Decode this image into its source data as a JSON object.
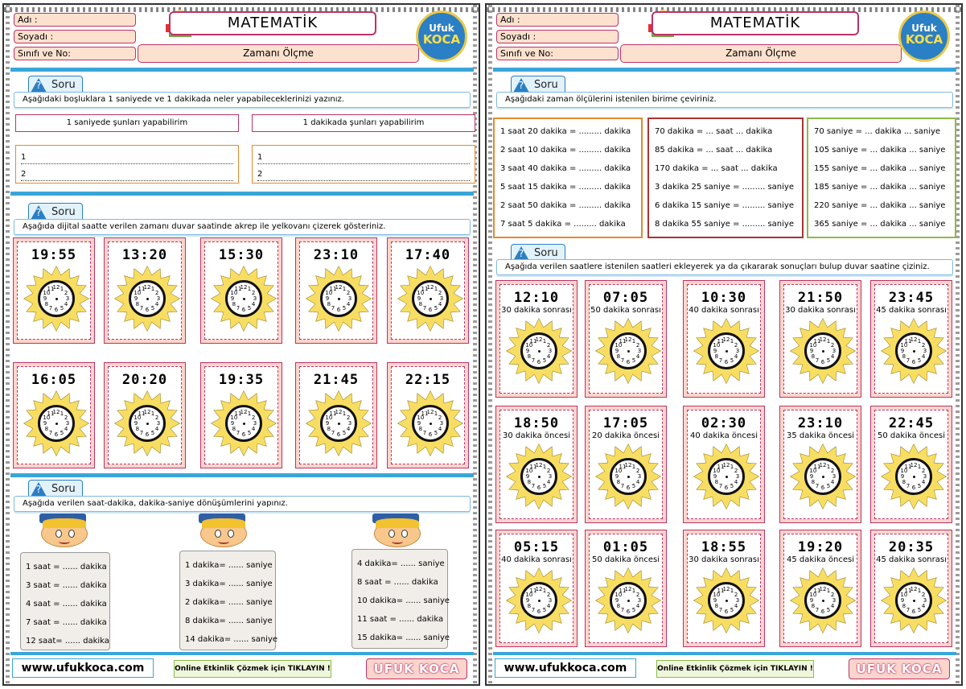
{
  "header": {
    "fields": [
      "Adı :",
      "Soyadı :",
      "Sınıfı ve No:"
    ],
    "title": "MATEMATİK",
    "subject": "Zamanı Ölçme",
    "logo_top": "Ufuk",
    "logo_bottom": "KOCA",
    "logo_url": "www.ufukkoca.com"
  },
  "soru_label": "Soru",
  "page1": {
    "q1": {
      "instruction": "Aşağıdaki boşluklara 1 saniyede ve 1 dakikada neler yapabileceklerinizi yazınız.",
      "left_label": "1 saniyede şunları yapabilirim",
      "right_label": "1 dakikada şunları yapabilirim",
      "lines": [
        "1",
        "2"
      ]
    },
    "q2": {
      "instruction": "Aşağıda dijital saatte verilen zamanı duvar saatinde akrep ile yelkovanı çizerek gösteriniz.",
      "times": [
        "19:55",
        "13:20",
        "15:30",
        "23:10",
        "17:40",
        "16:05",
        "20:20",
        "19:35",
        "21:45",
        "22:15"
      ]
    },
    "q3": {
      "instruction": "Aşağıda verilen saat-dakika, dakika-saniye dönüşümlerini yapınız.",
      "scroll1": [
        "1 saat  =  ...... dakika",
        "3 saat  =  ...... dakika",
        "4 saat  =  ...... dakika",
        "7 saat  =  ...... dakika",
        "12 saat= ...... dakika"
      ],
      "scroll2": [
        "1 dakika= ......  saniye",
        "3 dakika=  ......  saniye",
        "2 dakika=  ......  saniye",
        "8 dakika=  ......  saniye",
        "14 dakika=  ......  saniye"
      ],
      "scroll3": [
        "4 dakika=  ...... saniye",
        "8 saat   =  ...... dakika",
        "10 dakika= ...... saniye",
        "11 saat   =  ...... dakika",
        "15 dakika= ...... saniye"
      ]
    }
  },
  "page2": {
    "q1": {
      "instruction": "Aşağıdaki zaman ölçülerini istenilen birime çeviriniz.",
      "col1": [
        "1 saat 20 dakika  =  ......... dakika",
        "2 saat 10 dakika  =  ......... dakika",
        "3 saat 40 dakika =  ......... dakika",
        "5 saat 15 dakika  =  ......... dakika",
        "2 saat 50 dakika  =  ......... dakika",
        "7 saat 5 dakika   =  ......... dakika"
      ],
      "col2": [
        "70 dakika = ... saat   ... dakika",
        "85 dakika = ... saat   ... dakika",
        "170 dakika = ... saat   ... dakika",
        "3 dakika 25 saniye = ......... saniye",
        "6 dakika 15 saniye = ......... saniye",
        "8 dakika 55 saniye = ......... saniye"
      ],
      "col3": [
        "70 saniye = ... dakika   ... saniye",
        "105 saniye = ... dakika   ... saniye",
        "155 saniye = ... dakika   ... saniye",
        "185 saniye = ... dakika   ... saniye",
        "220 saniye = ... dakika   ... saniye",
        "365 saniye = ... dakika   ... saniye"
      ]
    },
    "q2": {
      "instruction": "Aşağıda verilen saatlere istenilen saatleri ekleyerek ya da çıkararak sonuçları bulup duvar saatine çiziniz.",
      "cards": [
        {
          "time": "12:10",
          "note": "30 dakika sonrası"
        },
        {
          "time": "07:05",
          "note": "50 dakika sonrası"
        },
        {
          "time": "10:30",
          "note": "40 dakika sonrası"
        },
        {
          "time": "21:50",
          "note": "30 dakika sonrası"
        },
        {
          "time": "23:45",
          "note": "45 dakika sonrası"
        },
        {
          "time": "18:50",
          "note": "30 dakika öncesi"
        },
        {
          "time": "17:05",
          "note": "20 dakika öncesi"
        },
        {
          "time": "02:30",
          "note": "40 dakika öncesi"
        },
        {
          "time": "23:10",
          "note": "35 dakika öncesi"
        },
        {
          "time": "22:45",
          "note": "50 dakika öncesi"
        },
        {
          "time": "05:15",
          "note": "40 dakika sonrası"
        },
        {
          "time": "01:05",
          "note": "50 dakika öncesi"
        },
        {
          "time": "18:55",
          "note": "30 dakika sonrası"
        },
        {
          "time": "19:20",
          "note": "45 dakika öncesi"
        },
        {
          "time": "20:35",
          "note": "45 dakika sonrası"
        }
      ]
    }
  },
  "footer": {
    "url": "www.ufukkoca.com",
    "online": "Online Etkinlik Çözmek için TIKLAYIN !",
    "brand": "UFUK KOCA"
  },
  "colors": {
    "accent_blue": "#39a5d8",
    "card_pink": "#fbd5cc",
    "border_red": "#b33366",
    "sun_yellow": "#f7de63"
  },
  "clock_numbers": [
    "12",
    "1",
    "2",
    "3",
    "4",
    "5",
    "6",
    "7",
    "8",
    "9",
    "10",
    "11"
  ]
}
